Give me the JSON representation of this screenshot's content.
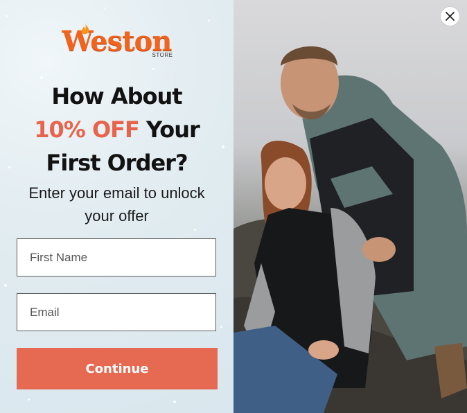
{
  "brand": {
    "logo_text": "Weston",
    "logo_subtext": "STORE"
  },
  "headline": {
    "line1": "How About",
    "highlight": "10% OFF",
    "line2_rest": " Your",
    "line3": "First Order?"
  },
  "subheadline": {
    "line1": "Enter your email to unlock",
    "line2": "your offer"
  },
  "form": {
    "first_name_placeholder": "First Name",
    "email_placeholder": "Email",
    "submit_label": "Continue"
  },
  "colors": {
    "accent": "#e8634c",
    "button": "#e66a52",
    "panel_bg": "#deeaf0",
    "logo": "#f0641e"
  },
  "icons": {
    "close": "close-icon"
  }
}
